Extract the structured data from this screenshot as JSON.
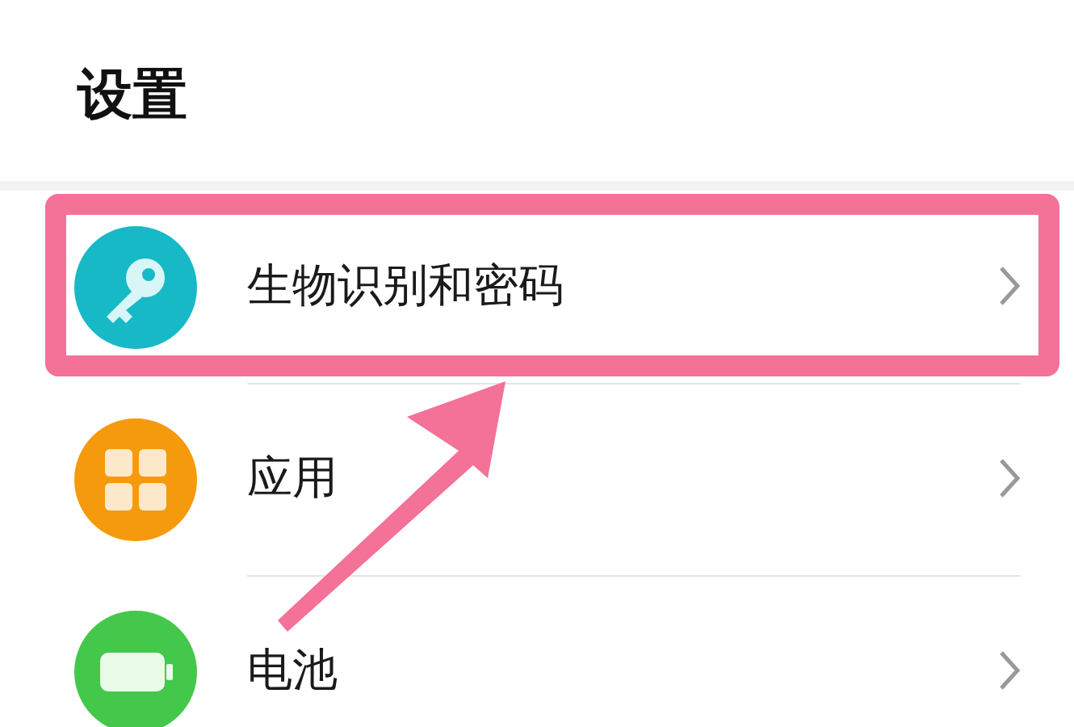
{
  "header": {
    "title": "设置"
  },
  "items": [
    {
      "kind": "key",
      "label": "生物识别和密码",
      "highlighted": true,
      "color": "#17b9c6"
    },
    {
      "kind": "apps",
      "label": "应用",
      "highlighted": false,
      "color": "#f59a0c"
    },
    {
      "kind": "battery",
      "label": "电池",
      "highlighted": false,
      "color": "#44c84c"
    }
  ]
}
